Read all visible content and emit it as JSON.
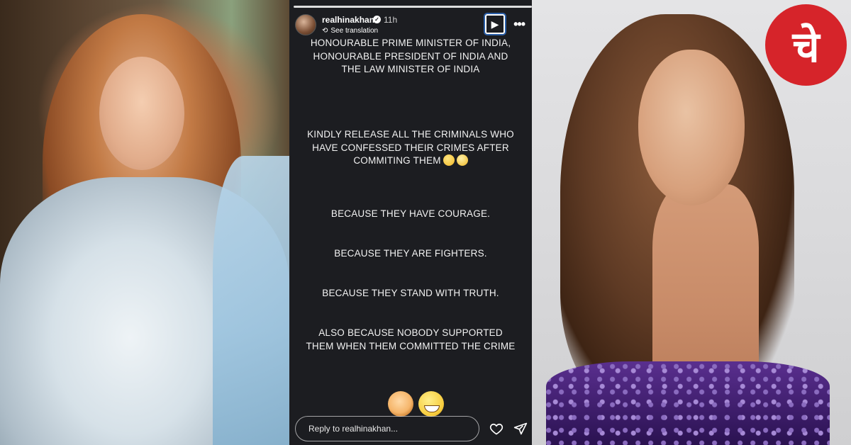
{
  "story": {
    "username": "realhinakhan",
    "time": "11h",
    "see_translation": "See translation",
    "paragraphs": {
      "p1": "HONOURABLE PRIME MINISTER OF INDIA, HONOURABLE PRESIDENT OF INDIA AND THE LAW MINISTER OF INDIA",
      "p2": "KINDLY RELEASE ALL THE CRIMINALS WHO HAVE CONFESSED THEIR CRIMES AFTER COMMITING THEM",
      "p3": "BECAUSE THEY HAVE COURAGE.",
      "p4": "BECAUSE THEY ARE FIGHTERS.",
      "p5": "BECAUSE THEY STAND WITH TRUTH.",
      "p6": "ALSO BECAUSE NOBODY SUPPORTED THEM WHEN THEM COMMITTED THE CRIME"
    },
    "reply_placeholder": "Reply to realhinakhan..."
  },
  "icons": {
    "play": "play-icon",
    "more": "more-icon",
    "heart": "heart-icon",
    "send": "send-icon",
    "verified": "verified-badge-icon",
    "translate": "translate-icon"
  },
  "brand": {
    "logo_text": "चे",
    "color": "#d6242a"
  },
  "colors": {
    "story_bg": "#1c1d21",
    "text": "#f2f2f2"
  }
}
